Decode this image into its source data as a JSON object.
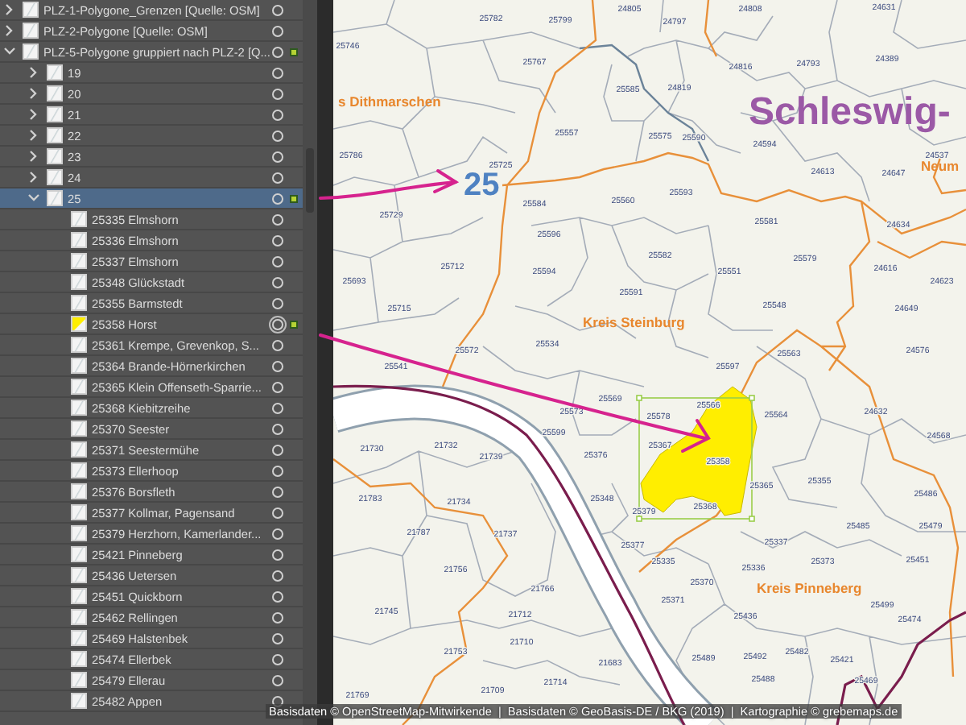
{
  "layers_panel": {
    "layers": [
      {
        "name": "PLZ-1-Polygone_Grenzen [Quelle: OSM]",
        "expanded": false,
        "selected": false,
        "marked": false
      },
      {
        "name": "PLZ-2-Polygone [Quelle: OSM]",
        "expanded": false,
        "selected": false,
        "marked": false
      },
      {
        "name": "PLZ-5-Polygone gruppiert nach PLZ-2 [Q...",
        "expanded": true,
        "selected": false,
        "marked": true,
        "children": [
          {
            "name": "19",
            "expanded": false,
            "selected": false,
            "marked": false
          },
          {
            "name": "20",
            "expanded": false,
            "selected": false,
            "marked": false
          },
          {
            "name": "21",
            "expanded": false,
            "selected": false,
            "marked": false
          },
          {
            "name": "22",
            "expanded": false,
            "selected": false,
            "marked": false
          },
          {
            "name": "23",
            "expanded": false,
            "selected": false,
            "marked": false
          },
          {
            "name": "24",
            "expanded": false,
            "selected": false,
            "marked": false
          },
          {
            "name": "25",
            "expanded": true,
            "selected": true,
            "marked": true,
            "children": [
              {
                "name": "25335 Elmshorn",
                "selected": false,
                "marked": false,
                "targeted": false,
                "highlighted": false
              },
              {
                "name": "25336 Elmshorn",
                "selected": false,
                "marked": false,
                "targeted": false,
                "highlighted": false
              },
              {
                "name": "25337 Elmshorn",
                "selected": false,
                "marked": false,
                "targeted": false,
                "highlighted": false
              },
              {
                "name": "25348 Glückstadt",
                "selected": false,
                "marked": false,
                "targeted": false,
                "highlighted": false
              },
              {
                "name": "25355 Barmstedt",
                "selected": false,
                "marked": false,
                "targeted": false,
                "highlighted": false
              },
              {
                "name": "25358 Horst",
                "selected": false,
                "marked": true,
                "targeted": true,
                "highlighted": true
              },
              {
                "name": "25361 Krempe, Grevenkop, S...",
                "selected": false,
                "marked": false,
                "targeted": false,
                "highlighted": false
              },
              {
                "name": "25364 Brande-Hörnerkirchen",
                "selected": false,
                "marked": false,
                "targeted": false,
                "highlighted": false
              },
              {
                "name": "25365 Klein Offenseth-Sparrie...",
                "selected": false,
                "marked": false,
                "targeted": false,
                "highlighted": false
              },
              {
                "name": "25368 Kiebitzreihe",
                "selected": false,
                "marked": false,
                "targeted": false,
                "highlighted": false
              },
              {
                "name": "25370 Seester",
                "selected": false,
                "marked": false,
                "targeted": false,
                "highlighted": false
              },
              {
                "name": "25371 Seestermühe",
                "selected": false,
                "marked": false,
                "targeted": false,
                "highlighted": false
              },
              {
                "name": "25373 Ellerhoop",
                "selected": false,
                "marked": false,
                "targeted": false,
                "highlighted": false
              },
              {
                "name": "25376 Borsfleth",
                "selected": false,
                "marked": false,
                "targeted": false,
                "highlighted": false
              },
              {
                "name": "25377 Kollmar, Pagensand",
                "selected": false,
                "marked": false,
                "targeted": false,
                "highlighted": false
              },
              {
                "name": "25379 Herzhorn, Kamerlander...",
                "selected": false,
                "marked": false,
                "targeted": false,
                "highlighted": false
              },
              {
                "name": "25421 Pinneberg",
                "selected": false,
                "marked": false,
                "targeted": false,
                "highlighted": false
              },
              {
                "name": "25436 Uetersen",
                "selected": false,
                "marked": false,
                "targeted": false,
                "highlighted": false
              },
              {
                "name": "25451 Quickborn",
                "selected": false,
                "marked": false,
                "targeted": false,
                "highlighted": false
              },
              {
                "name": "25462 Rellingen",
                "selected": false,
                "marked": false,
                "targeted": false,
                "highlighted": false
              },
              {
                "name": "25469 Halstenbek",
                "selected": false,
                "marked": false,
                "targeted": false,
                "highlighted": false
              },
              {
                "name": "25474 Ellerbek",
                "selected": false,
                "marked": false,
                "targeted": false,
                "highlighted": false
              },
              {
                "name": "25479 Ellerau",
                "selected": false,
                "marked": false,
                "targeted": false,
                "highlighted": false
              },
              {
                "name": "25482 Appen",
                "selected": false,
                "marked": false,
                "targeted": false,
                "highlighted": false
              }
            ]
          }
        ]
      }
    ]
  },
  "map": {
    "state_label": "Schleswig-",
    "district_labels": [
      "s Dithmarschen",
      "Neum",
      "Kreis Steinburg",
      "Kreis Pinneberg"
    ],
    "region_number": "25",
    "highlighted_postcode": "25358",
    "postcode_labels": [
      "25782",
      "25799",
      "24805",
      "24797",
      "24808",
      "24631",
      "25746",
      "25767",
      "24816",
      "24793",
      "24389",
      "25585",
      "24819",
      "25557",
      "25575",
      "25590",
      "24594",
      "25786",
      "25725",
      "24613",
      "24647",
      "24537",
      "25584",
      "25560",
      "25593",
      "25729",
      "25581",
      "24634",
      "25596",
      "25582",
      "25579",
      "25712",
      "25594",
      "25551",
      "24616",
      "25693",
      "24623",
      "25591",
      "25715",
      "25548",
      "24649",
      "25572",
      "25534",
      "25563",
      "24576",
      "25541",
      "25597",
      "25573",
      "25569",
      "25578",
      "25566",
      "25564",
      "24632",
      "25599",
      "25367",
      "24568",
      "21730",
      "21732",
      "21739",
      "25376",
      "25365",
      "25355",
      "25486",
      "21783",
      "21734",
      "25348",
      "25379",
      "25368",
      "25485",
      "25479",
      "21787",
      "21737",
      "25377",
      "25337",
      "25335",
      "25336",
      "25373",
      "25451",
      "21756",
      "25370",
      "21766",
      "25371",
      "25499",
      "25436",
      "25474",
      "21745",
      "21712",
      "21710",
      "21753",
      "21683",
      "25489",
      "25492",
      "25482",
      "25421",
      "21714",
      "25488",
      "25469",
      "21709",
      "21769"
    ]
  },
  "attribution": "Basisdaten © OpenStreetMap-Mitwirkende  |  Basisdaten © GeoBasis-DE / BKG (2019)  |  Kartographie © grebemaps.de"
}
